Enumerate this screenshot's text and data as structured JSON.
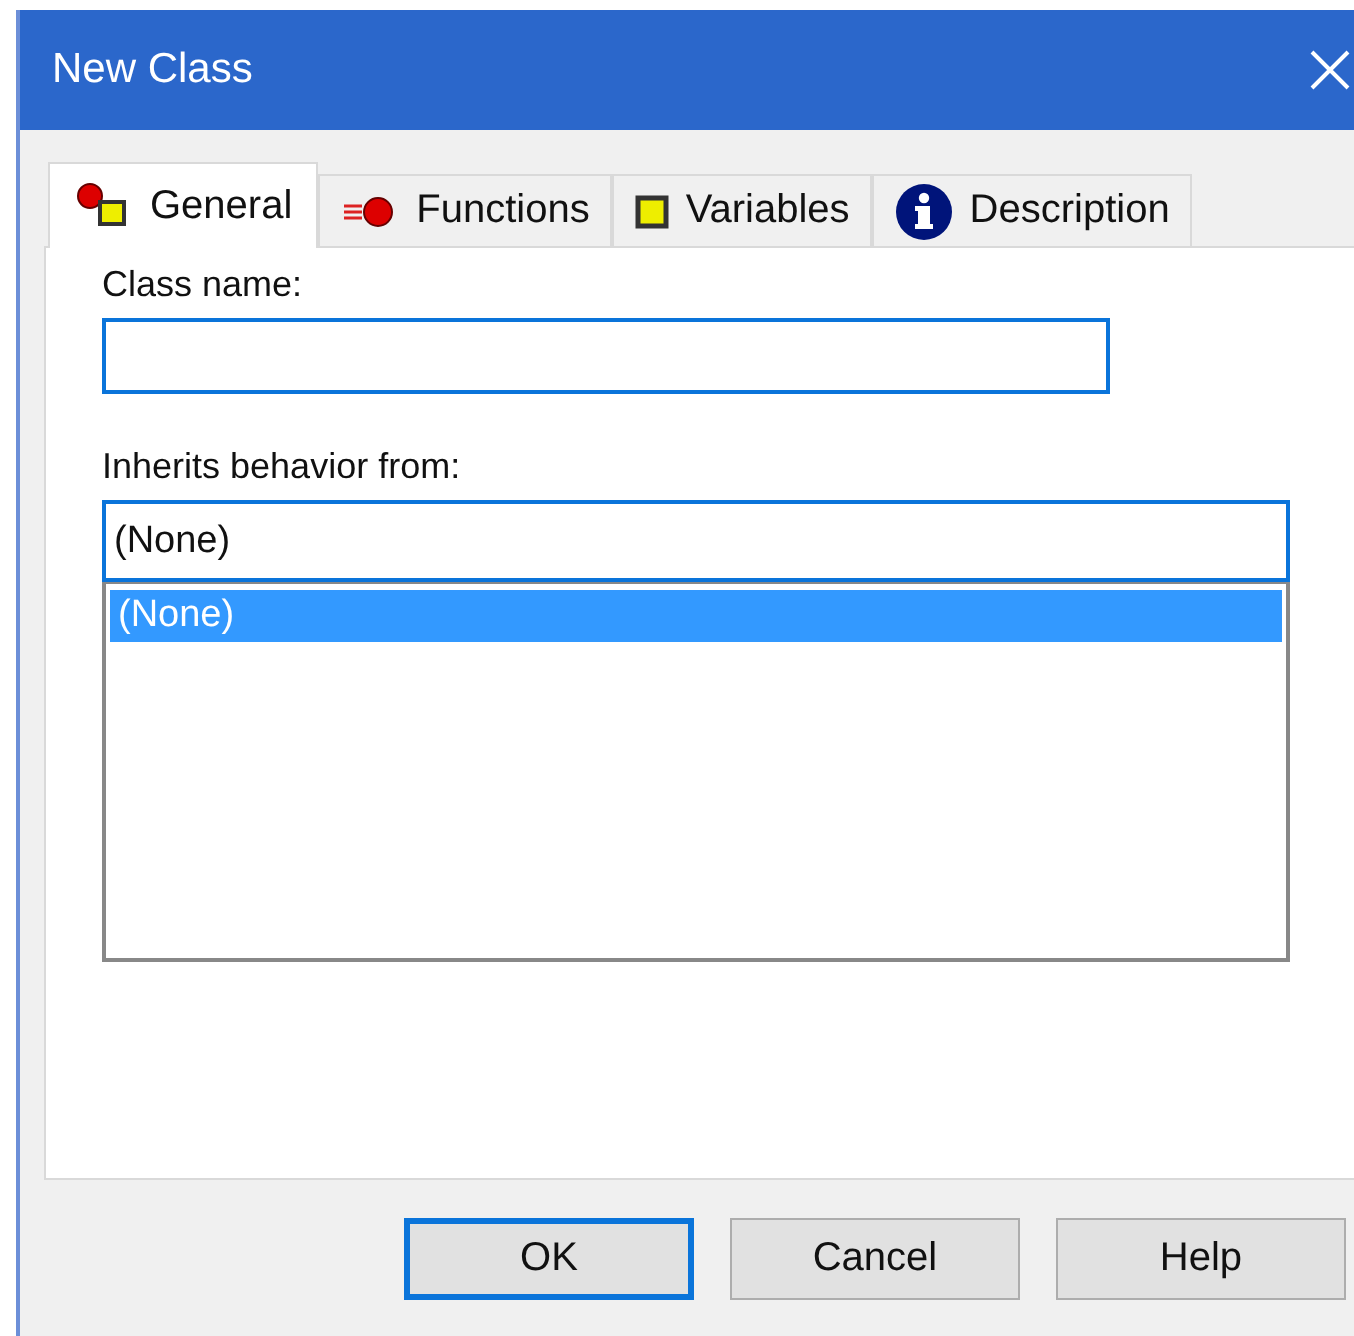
{
  "window": {
    "title": "New Class"
  },
  "tabs": [
    {
      "label": "General",
      "selected": true,
      "kind": "general"
    },
    {
      "label": "Functions",
      "selected": false,
      "kind": "functions"
    },
    {
      "label": "Variables",
      "selected": false,
      "kind": "variables"
    },
    {
      "label": "Description",
      "selected": false,
      "kind": "description"
    }
  ],
  "class_name": {
    "label": "Class name:"
  },
  "inherits": {
    "label": "Inherits behavior from:",
    "value": "(None)",
    "options": [
      {
        "label": "(None)",
        "selected": true
      }
    ]
  },
  "buttons": [
    {
      "label": "OK",
      "default": true
    },
    {
      "label": "Cancel",
      "default": false
    },
    {
      "label": "Help",
      "default": false
    }
  ]
}
